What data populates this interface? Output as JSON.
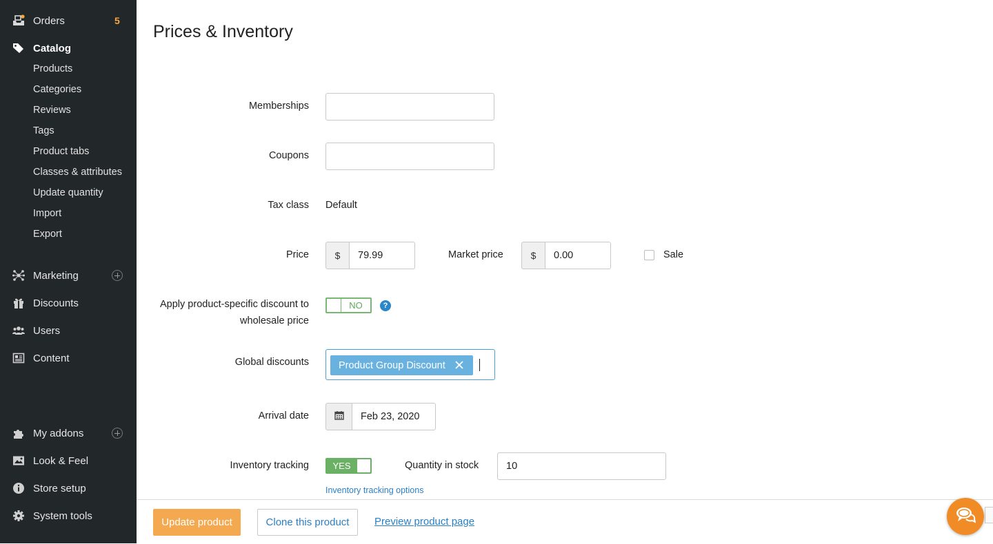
{
  "sidebar": {
    "orders": {
      "label": "Orders",
      "badge": "5"
    },
    "catalog": {
      "label": "Catalog",
      "items": [
        "Products",
        "Categories",
        "Reviews",
        "Tags",
        "Product tabs",
        "Classes & attributes",
        "Update quantity",
        "Import",
        "Export"
      ]
    },
    "marketing": {
      "label": "Marketing"
    },
    "discounts": {
      "label": "Discounts"
    },
    "users": {
      "label": "Users"
    },
    "content": {
      "label": "Content"
    },
    "my_addons": {
      "label": "My addons"
    },
    "look_feel": {
      "label": "Look & Feel"
    },
    "store_setup": {
      "label": "Store setup"
    },
    "system_tools": {
      "label": "System tools"
    }
  },
  "page": {
    "title": "Prices & Inventory"
  },
  "form": {
    "memberships": {
      "label": "Memberships",
      "value": ""
    },
    "coupons": {
      "label": "Coupons",
      "value": ""
    },
    "tax_class": {
      "label": "Tax class",
      "value": "Default"
    },
    "price": {
      "label": "Price",
      "currency": "$",
      "value": "79.99"
    },
    "market_price": {
      "label": "Market price",
      "currency": "$",
      "value": "0.00"
    },
    "sale": {
      "label": "Sale",
      "checked": false
    },
    "wholesale_discount": {
      "label_line1": "Apply product-specific discount to",
      "label_line2": "wholesale price",
      "toggle": "NO"
    },
    "global_discounts": {
      "label": "Global discounts",
      "chips": [
        "Product Group Discount"
      ]
    },
    "arrival_date": {
      "label": "Arrival date",
      "value": "Feb 23, 2020"
    },
    "inventory_tracking": {
      "label": "Inventory tracking",
      "toggle": "YES",
      "options_link": "Inventory tracking options"
    },
    "quantity_in_stock": {
      "label": "Quantity in stock",
      "value": "10"
    }
  },
  "actions": {
    "update": "Update product",
    "clone": "Clone this product",
    "preview": "Preview product page"
  },
  "colors": {
    "sidebar_bg": "#22272a",
    "accent_orange": "#f4a950",
    "link_blue": "#2a7fc6",
    "toggle_green": "#6ab165",
    "chip_blue": "#69b2e0"
  },
  "icons": {
    "orders": "inbox-tray-icon",
    "catalog": "tags-icon",
    "marketing": "network-icon",
    "discounts": "gift-icon",
    "users": "users-group-icon",
    "content": "newspaper-icon",
    "my_addons": "puzzle-icon",
    "look_feel": "picture-icon",
    "store_setup": "info-icon",
    "system_tools": "gear-icon",
    "arrival_date": "calendar-icon",
    "chat": "chat-bubbles-icon"
  }
}
